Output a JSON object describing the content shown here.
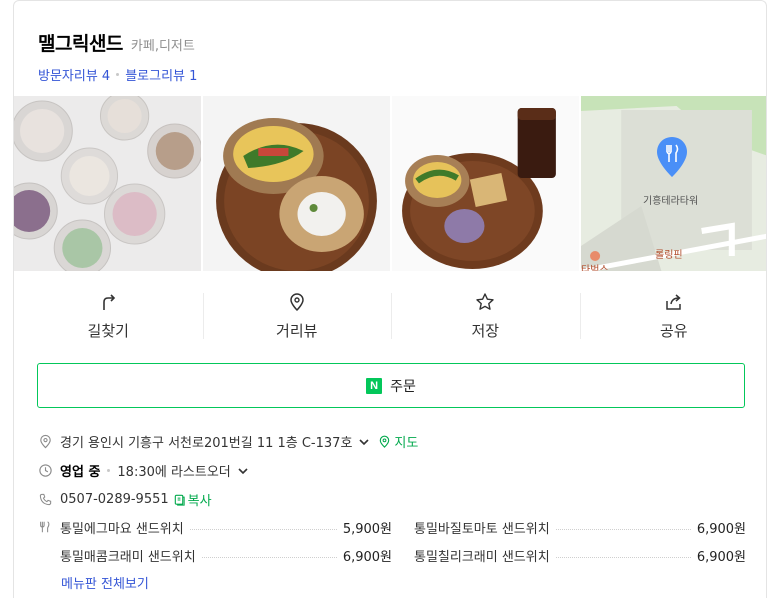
{
  "place": {
    "name": "맬그릭샌드",
    "category": "카페,디저트",
    "visitor_reviews": "방문자리뷰 4",
    "blog_reviews": "블로그리뷰 1"
  },
  "map": {
    "building": "기흥테라타워",
    "poi1": "롤링핀",
    "poi2": "타벅스"
  },
  "actions": [
    {
      "label": "길찾기",
      "icon": "directions-icon"
    },
    {
      "label": "거리뷰",
      "icon": "location-pin-icon"
    },
    {
      "label": "저장",
      "icon": "star-icon"
    },
    {
      "label": "공유",
      "icon": "share-icon"
    }
  ],
  "order": {
    "logo": "N",
    "label": "주문"
  },
  "info": {
    "address": "경기 용인시 기흥구 서천로201번길 11 1층 C-137호",
    "map_link": "지도",
    "status": "영업 중",
    "hours": "18:30에 라스트오더",
    "phone": "0507-0289-9551",
    "copy": "복사"
  },
  "menu": [
    {
      "name": "통밀에그마요 샌드위치",
      "price": "5,900원"
    },
    {
      "name": "통밀바질토마토 샌드위치",
      "price": "6,900원"
    },
    {
      "name": "통밀매콤크래미 샌드위치",
      "price": "6,900원"
    },
    {
      "name": "통밀칠리크래미 샌드위치",
      "price": "6,900원"
    }
  ],
  "menu_more": "메뉴판 전체보기",
  "colors": {
    "accent_green": "#03c75a",
    "link_blue": "#3455d6",
    "map_pin": "#4a8ff7"
  }
}
